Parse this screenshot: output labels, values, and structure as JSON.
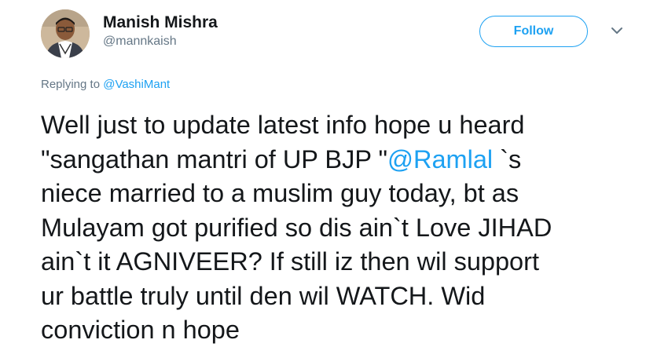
{
  "author": {
    "display_name": "Manish Mishra",
    "handle": "@mannkaish"
  },
  "actions": {
    "follow_label": "Follow",
    "menu_icon": "chevron-down-icon"
  },
  "reply_context": {
    "prefix": "Replying to",
    "mention": "@VashiMant"
  },
  "tweet": {
    "line1": "Well just to update latest info hope u heard",
    "line2_before": "\"sangathan mantri of UP BJP \"",
    "line2_mention": "@Ramlal",
    "line2_after": " `s",
    "line3": "niece married to a muslim guy today, bt as",
    "line4": "Mulayam got purified so dis ain`t Love JIHAD",
    "line5": "ain`t it AGNIVEER? If still iz then wil support",
    "line6": "ur battle truly until den wil WATCH. Wid",
    "line7": "conviction n hope"
  },
  "colors": {
    "accent": "#1da1f2",
    "text": "#14171a",
    "muted": "#657786"
  }
}
